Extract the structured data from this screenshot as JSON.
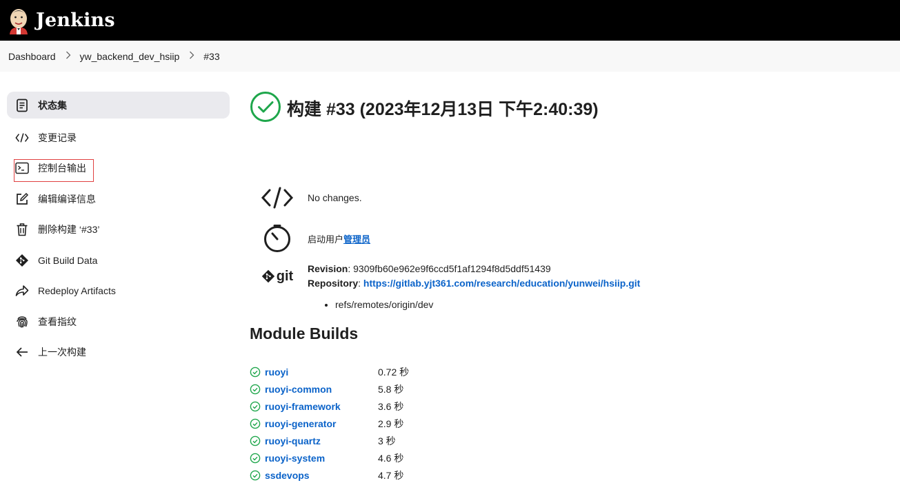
{
  "header": {
    "brand": "Jenkins"
  },
  "breadcrumb": [
    {
      "label": "Dashboard"
    },
    {
      "label": "yw_backend_dev_hsiip"
    },
    {
      "label": "#33"
    }
  ],
  "sidebar": {
    "items": [
      {
        "label": "状态集",
        "icon": "status-icon"
      },
      {
        "label": "变更记录",
        "icon": "code-icon"
      },
      {
        "label": "控制台输出",
        "icon": "terminal-icon"
      },
      {
        "label": "编辑编译信息",
        "icon": "edit-icon"
      },
      {
        "label": "删除构建 ‘#33’",
        "icon": "trash-icon"
      },
      {
        "label": "Git Build Data",
        "icon": "git-icon"
      },
      {
        "label": "Redeploy Artifacts",
        "icon": "share-icon"
      },
      {
        "label": "查看指纹",
        "icon": "fingerprint-icon"
      },
      {
        "label": "上一次构建",
        "icon": "arrow-left-icon"
      }
    ]
  },
  "main": {
    "title": "构建 #33 (2023年12月13日 下午2:40:39)",
    "changes": "No changes.",
    "started_by_prefix": "启动用户",
    "started_by_user": "管理员",
    "git": {
      "logo_text": "git",
      "revision_label": "Revision",
      "revision": "9309fb60e962e9f6ccd5f1af1294f8d5ddf51439",
      "repository_label": "Repository",
      "repository": "https://gitlab.yjt361.com/research/education/yunwei/hsiip.git",
      "branches": [
        "refs/remotes/origin/dev"
      ]
    },
    "module_builds_title": "Module Builds",
    "modules": [
      {
        "name": "ruoyi",
        "duration": "0.72 秒"
      },
      {
        "name": "ruoyi-common",
        "duration": "5.8 秒"
      },
      {
        "name": "ruoyi-framework",
        "duration": "3.6 秒"
      },
      {
        "name": "ruoyi-generator",
        "duration": "2.9 秒"
      },
      {
        "name": "ruoyi-quartz",
        "duration": "3 秒"
      },
      {
        "name": "ruoyi-system",
        "duration": "4.6 秒"
      },
      {
        "name": "ssdevops",
        "duration": "4.7 秒"
      }
    ]
  },
  "colors": {
    "success": "#1ea64b",
    "link": "#0b63c9",
    "header_bg": "#000000"
  }
}
